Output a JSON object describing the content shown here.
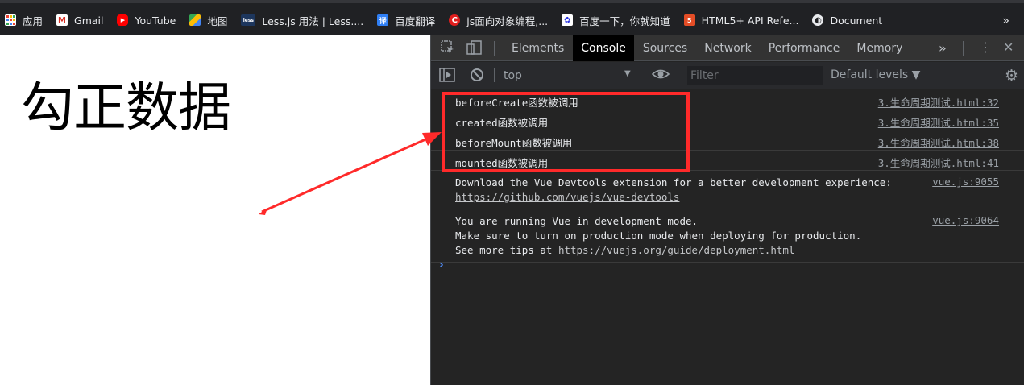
{
  "bookmarks": [
    {
      "label": "应用",
      "icon": "apps-grid-icon",
      "color": "#e8453c"
    },
    {
      "label": "Gmail",
      "icon": "gmail-icon",
      "color": "#d93025"
    },
    {
      "label": "YouTube",
      "icon": "youtube-icon",
      "color": "#ff0000"
    },
    {
      "label": "地图",
      "icon": "maps-icon",
      "color": "#34a853"
    },
    {
      "label": "Less.js 用法 | Less....",
      "icon": "less-icon",
      "color": "#1d365d"
    },
    {
      "label": "百度翻译",
      "icon": "translate-icon",
      "color": "#2f7ff5"
    },
    {
      "label": "js面向对象编程,...",
      "icon": "csdn-icon",
      "color": "#e11d1d"
    },
    {
      "label": "百度一下，你就知道",
      "icon": "baidu-icon",
      "color": "#2932e1"
    },
    {
      "label": "HTML5+ API Refe...",
      "icon": "html5-icon",
      "color": "#e44d26"
    },
    {
      "label": "Document",
      "icon": "globe-icon",
      "color": "#9aa0a6"
    }
  ],
  "bookmarks_more": "»",
  "page": {
    "heading": "勾正数据"
  },
  "devtools": {
    "tabs": [
      "Elements",
      "Console",
      "Sources",
      "Network",
      "Performance",
      "Memory"
    ],
    "active_tab": "Console",
    "more_tabs": "»",
    "context": "top",
    "filter_placeholder": "Filter",
    "levels": "Default levels ▼",
    "logs": [
      {
        "message": "beforeCreate函数被调用",
        "source": "3.生命周期测试.html:32"
      },
      {
        "message": "created函数被调用",
        "source": "3.生命周期测试.html:35"
      },
      {
        "message": "beforeMount函数被调用",
        "source": "3.生命周期测试.html:38"
      },
      {
        "message": "mounted函数被调用",
        "source": "3.生命周期测试.html:41"
      }
    ],
    "devtools_msg": {
      "line1": "Download the Vue Devtools extension for a better development experience:",
      "link": "https://github.com/vuejs/vue-devtools",
      "source": "vue.js:9055"
    },
    "mode_msg": {
      "line1": "You are running Vue in development mode.",
      "line2": "Make sure to turn on production mode when deploying for production.",
      "line3_prefix": "See more tips at ",
      "link": "https://vuejs.org/guide/deployment.html",
      "source": "vue.js:9064"
    },
    "prompt": "›"
  },
  "colors": {
    "annotation_red": "#ff2a2a",
    "accent_blue": "#4f8bf5"
  }
}
